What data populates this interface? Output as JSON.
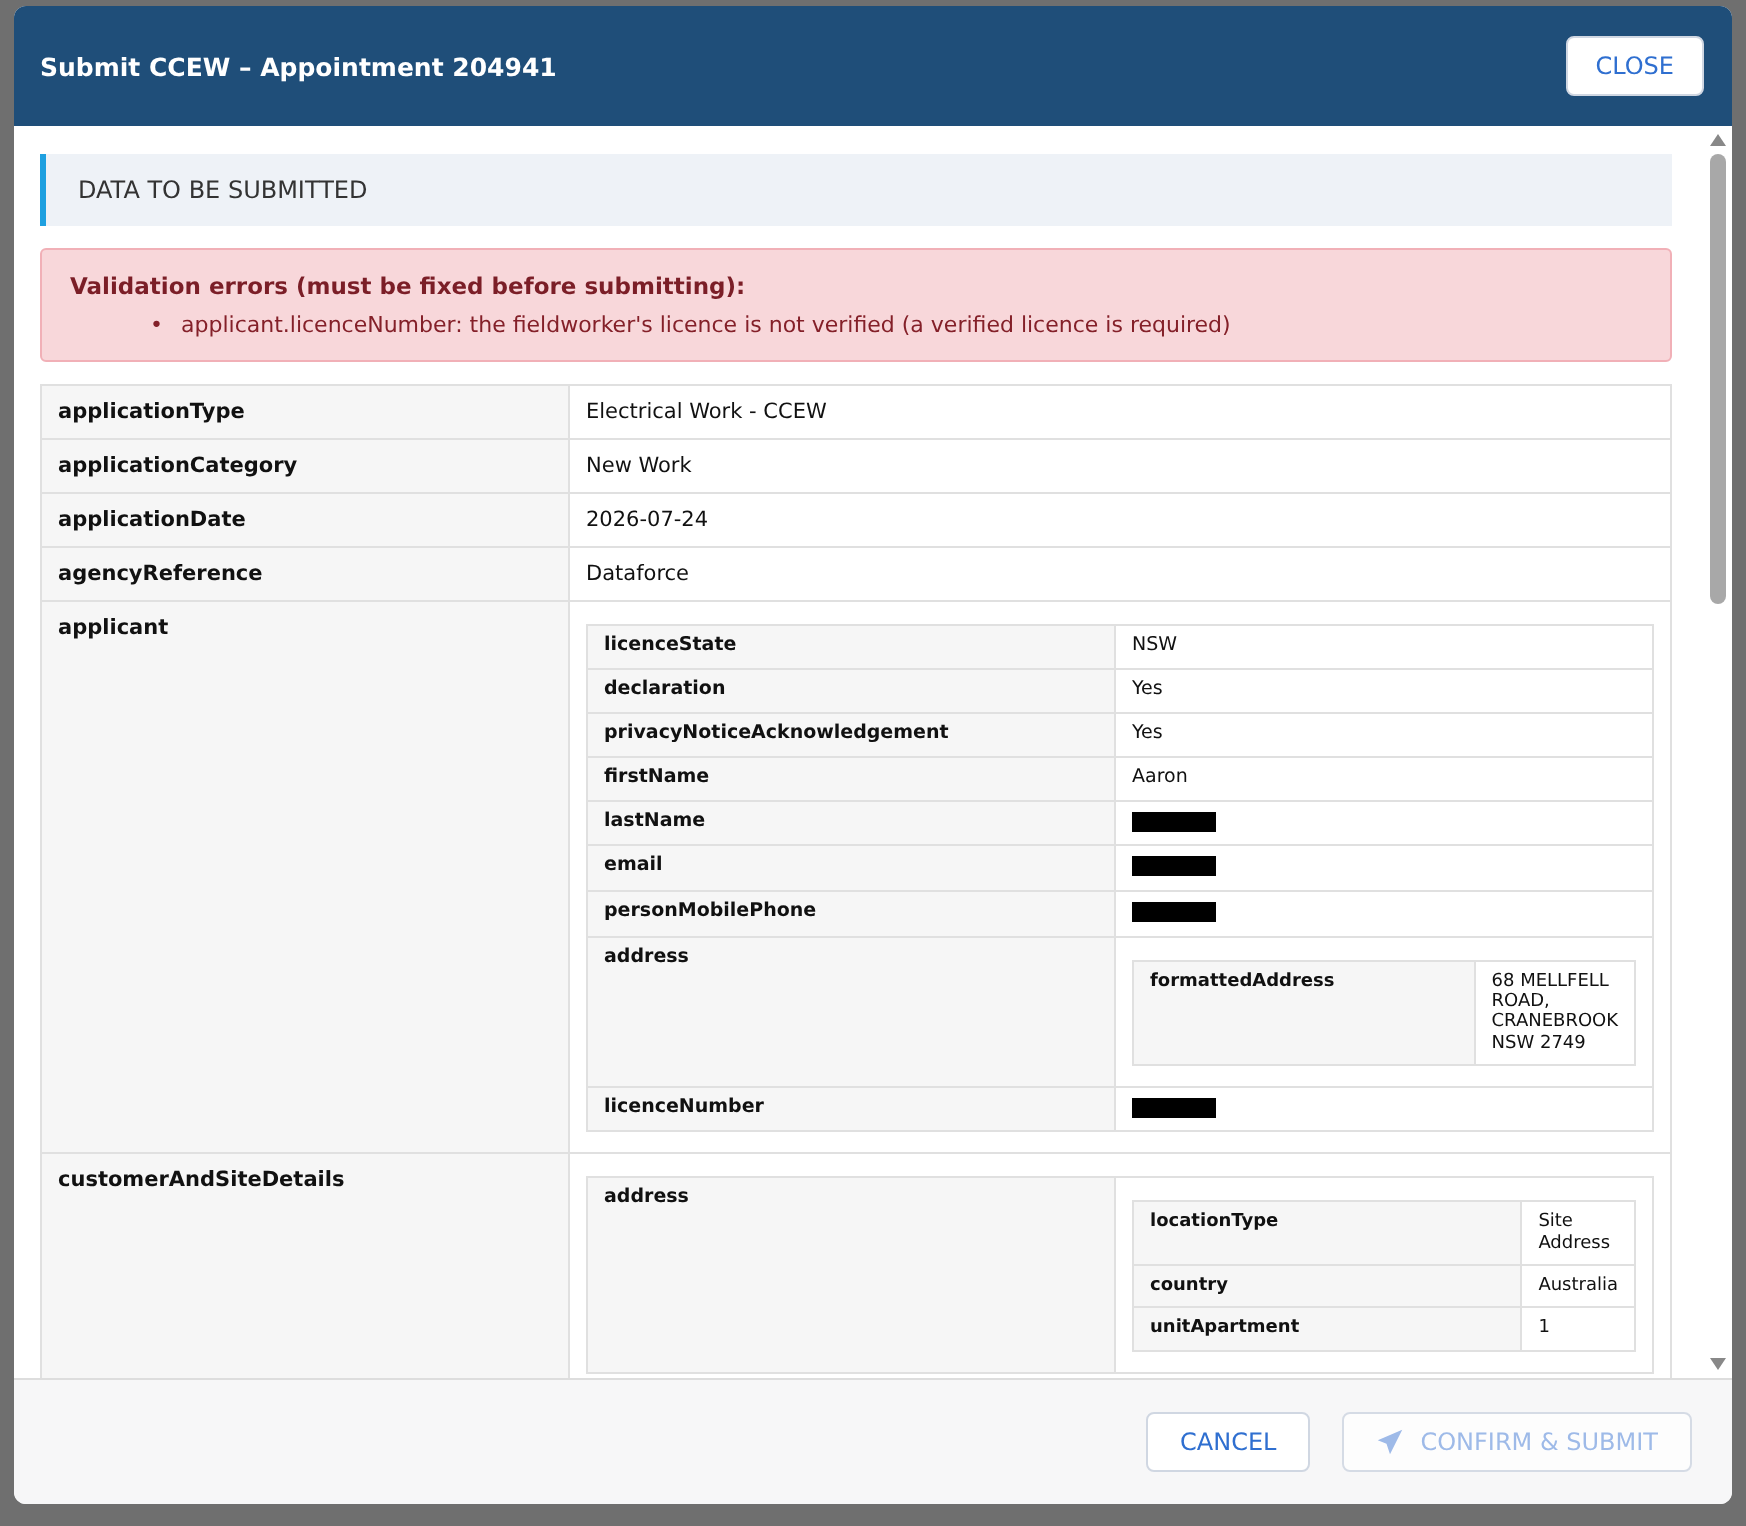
{
  "dialog": {
    "title": "Submit CCEW – Appointment 204941",
    "close_button": "CLOSE"
  },
  "section_title": "DATA TO BE SUBMITTED",
  "validation": {
    "heading": "Validation errors (must be fixed before submitting):",
    "bullet": "•",
    "errors": [
      "applicant.licenceNumber: the fieldworker's licence is not verified (a verified licence is required)"
    ]
  },
  "rows": [
    {
      "key": "applicationType",
      "kind": "text",
      "value": "Electrical Work - CCEW"
    },
    {
      "key": "applicationCategory",
      "kind": "text",
      "value": "New Work"
    },
    {
      "key": "applicationDate",
      "kind": "text",
      "value": "2026-07-24"
    },
    {
      "key": "agencyReference",
      "kind": "text",
      "value": "Dataforce"
    },
    {
      "key": "applicant",
      "kind": "table",
      "rows": [
        {
          "key": "licenceState",
          "kind": "text",
          "value": "NSW"
        },
        {
          "key": "declaration",
          "kind": "text",
          "value": "Yes"
        },
        {
          "key": "privacyNoticeAcknowledgement",
          "kind": "text",
          "value": "Yes"
        },
        {
          "key": "firstName",
          "kind": "text",
          "value": "Aaron"
        },
        {
          "key": "lastName",
          "kind": "redacted"
        },
        {
          "key": "email",
          "kind": "redacted"
        },
        {
          "key": "personMobilePhone",
          "kind": "redacted"
        },
        {
          "key": "address",
          "kind": "table",
          "rows": [
            {
              "key": "formattedAddress",
              "kind": "text",
              "value": "68 MELLFELL ROAD, CRANEBROOK NSW 2749"
            }
          ]
        },
        {
          "key": "licenceNumber",
          "kind": "redacted"
        }
      ]
    },
    {
      "key": "customerAndSiteDetails",
      "kind": "table",
      "rows": [
        {
          "key": "address",
          "kind": "table",
          "rows": [
            {
              "key": "locationType",
              "kind": "text",
              "value": "Site Address"
            },
            {
              "key": "country",
              "kind": "text",
              "value": "Australia"
            },
            {
              "key": "unitApartment",
              "kind": "text",
              "value": "1"
            }
          ]
        }
      ]
    }
  ],
  "footer": {
    "buttons": [
      {
        "label": "CANCEL",
        "kind": "plain",
        "disabled": false
      },
      {
        "label": "CONFIRM & SUBMIT",
        "kind": "submit",
        "disabled": true
      }
    ]
  }
}
